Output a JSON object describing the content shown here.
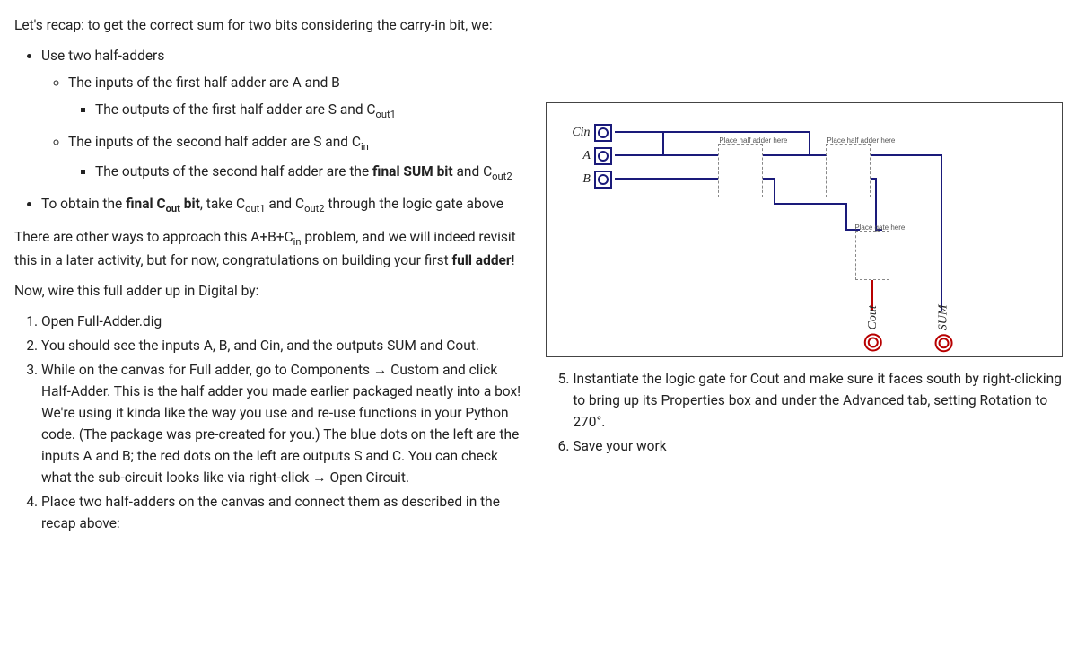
{
  "intro": "Let's recap: to get the correct sum for two bits considering the carry-in bit, we:",
  "recap": {
    "b1": "Use two half-adders",
    "b1a": "The inputs of the first half adder are A and B",
    "b1a1_pre": "The outputs of the first half adder are S and C",
    "b1a1_sub": "out1",
    "b1b_pre": "The inputs of the second half adder are S and C",
    "b1b_sub": "in",
    "b1b1_pre": "The outputs of the second half adder are the ",
    "b1b1_bold": "final SUM bit",
    "b1b1_mid": " and C",
    "b1b1_sub": "out2",
    "b2_pre": "To obtain the ",
    "b2_bold": "final C",
    "b2_boldsub": "out",
    "b2_bold2": " bit",
    "b2_mid": ", take C",
    "b2_sub1": "out1",
    "b2_mid2": " and C",
    "b2_sub2": "out2",
    "b2_post": " through the logic gate above"
  },
  "para2_pre": "There are other ways to approach this A+B+C",
  "para2_sub": "in",
  "para2_mid": " problem, and we will indeed revisit this in a later activity, but for now, congratulations on building your first ",
  "para2_bold": "full adder",
  "para2_post": "!",
  "para3": "Now, wire this full adder up in Digital by:",
  "steps": {
    "s1": "Open Full-Adder.dig",
    "s2": "You should see the inputs A, B, and Cin, and the outputs SUM and Cout.",
    "s3": "While on the canvas for Full adder, go to Components → Custom and click Half-Adder. This is the half adder you made earlier packaged neatly into a box! We're using it kinda like the way you use and re-use functions in your Python code. (The package was pre-created for you.) The blue dots on the left are the inputs A and B; the red dots on the left are outputs S and C. You can check what the sub-circuit looks like via right-click → Open Circuit.",
    "s4": "Place two half-adders on the canvas and connect them as described in the recap above:",
    "s5": "Instantiate the logic gate for Cout and make sure it faces south by right-clicking to bring up its Properties box and under the Advanced tab, setting Rotation to 270°.",
    "s6": "Save your work"
  },
  "diagram": {
    "cin": "Cin",
    "a": "A",
    "b": "B",
    "half1": "Place half adder here",
    "half2": "Place half adder here",
    "gate": "Place gate here",
    "cout": "Cout",
    "sum": "SUM"
  }
}
